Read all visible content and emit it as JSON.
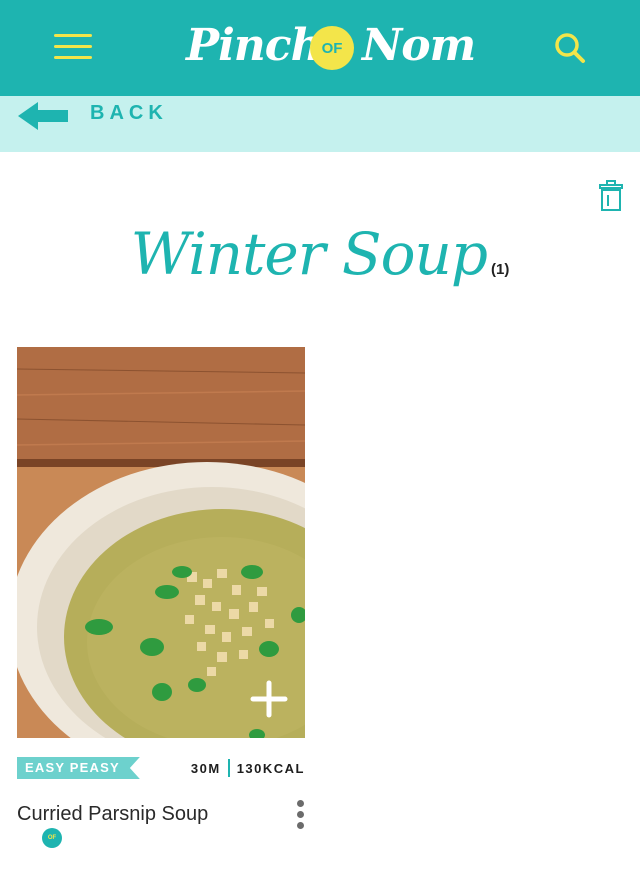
{
  "header": {
    "logo_word1": "Pinch",
    "logo_badge": "OF",
    "logo_word2": "Nom",
    "menu_icon": "hamburger-icon",
    "search_icon": "search-icon"
  },
  "back": {
    "label": "BACK",
    "icon": "arrow-left-icon"
  },
  "collection": {
    "title": "Winter Soup",
    "count": "(1)",
    "delete_icon": "trash-icon"
  },
  "recipes": [
    {
      "tag": "EASY PEASY",
      "time": "30M",
      "calories": "130KCAL",
      "title": "Curried Parsnip Soup",
      "logo_badge": "OF",
      "menu_icon": "kebab-menu-icon"
    }
  ],
  "colors": {
    "brand_teal": "#1eb4b0",
    "brand_yellow": "#f3e54a",
    "back_bar": "#c5f1ee",
    "tag_bg": "#6dd1cd"
  }
}
